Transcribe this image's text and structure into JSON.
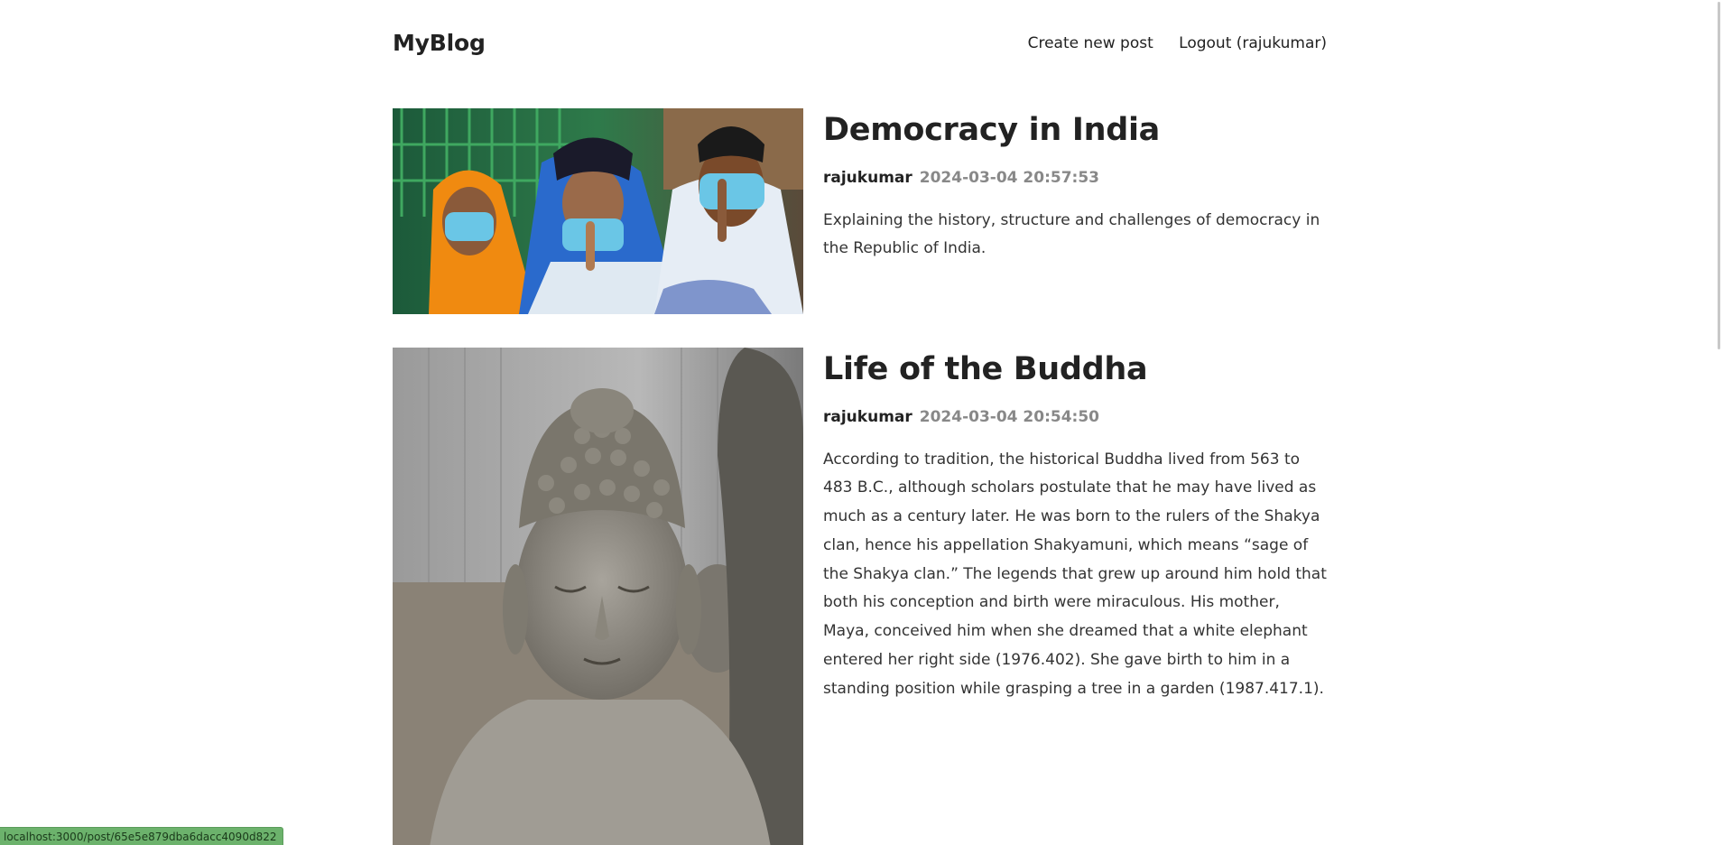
{
  "header": {
    "logo": "MyBlog",
    "nav": {
      "create": "Create new post",
      "logout": "Logout (rajukumar)"
    }
  },
  "posts": [
    {
      "title": "Democracy in India",
      "author": "rajukumar",
      "date": "2024-03-04 20:57:53",
      "summary": "Explaining the history, structure and challenges of democracy in the Republic of India.",
      "image_icon": "voters-with-masks-image"
    },
    {
      "title": "Life of the Buddha",
      "author": "rajukumar",
      "date": "2024-03-04 20:54:50",
      "summary": "According to tradition, the historical Buddha lived from 563 to 483 B.C., although scholars postulate that he may have lived as much as a century later. He was born to the rulers of the Shakya clan, hence his appellation Shakyamuni, which means “sage of the Shakya clan.” The legends that grew up around him hold that both his conception and birth were miraculous. His mother, Maya, conceived him when she dreamed that a white elephant entered her right side (1976.402). She gave birth to him in a standing position while grasping a tree in a garden (1987.417.1).",
      "image_icon": "buddha-statue-image"
    }
  ],
  "status_bar": {
    "url": "localhost:3000/post/65e5e879dba6dacc4090d822"
  }
}
